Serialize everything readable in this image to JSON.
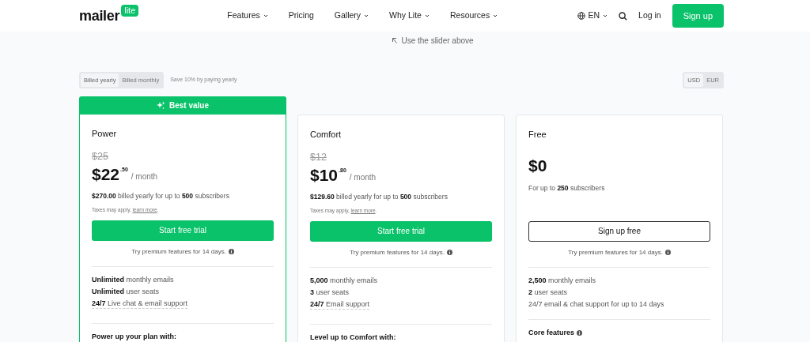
{
  "nav": {
    "logo_word": "mailer",
    "logo_badge": "lite",
    "menu": [
      {
        "label": "Features",
        "dropdown": true
      },
      {
        "label": "Pricing",
        "dropdown": false
      },
      {
        "label": "Gallery",
        "dropdown": true
      },
      {
        "label": "Why Lite",
        "dropdown": true
      },
      {
        "label": "Resources",
        "dropdown": true
      }
    ],
    "language": "EN",
    "login": "Log in",
    "signup": "Sign up"
  },
  "hint": "Use the slider above",
  "billing": {
    "options": [
      {
        "label": "Billed yearly",
        "selected": true
      },
      {
        "label": "Billed monthly",
        "selected": false
      }
    ],
    "note": "Save 10% by paying yearly"
  },
  "currency": [
    {
      "label": "USD",
      "selected": true
    },
    {
      "label": "EUR",
      "selected": false
    }
  ],
  "plans": [
    {
      "name": "Power",
      "badge": "Best value",
      "highlighted": true,
      "old_price": "$25",
      "price": "$22",
      "cents": ".50",
      "period": "/ month",
      "billing": "**$270.00** billed yearly for up to **500** subscribers",
      "taxes": {
        "text": "Taxes may apply, ",
        "link": "learn more",
        "end": "."
      },
      "button": {
        "label": "Start free trial",
        "kind": "primary"
      },
      "trial_note": "Try premium features for 14 days.",
      "features": [
        {
          "text": "**Unlimited** monthly emails",
          "dotted": false
        },
        {
          "text": "**Unlimited** user seats",
          "dotted": false
        },
        {
          "text": "**24/7** Live chat & email support",
          "dotted": true
        }
      ],
      "section_title": "Power up your plan with:",
      "section_info": false
    },
    {
      "name": "Comfort",
      "highlighted": false,
      "old_price": "$12",
      "price": "$10",
      "cents": ".80",
      "period": "/ month",
      "billing": "**$129.60** billed yearly for up to **500** subscribers",
      "taxes": {
        "text": "Taxes may apply, ",
        "link": "learn more",
        "end": "."
      },
      "button": {
        "label": "Start free trial",
        "kind": "primary"
      },
      "trial_note": "Try premium features for 14 days.",
      "features": [
        {
          "text": "**5,000** monthly emails",
          "dotted": false
        },
        {
          "text": "**3** user seats",
          "dotted": false
        },
        {
          "text": "**24/7** Email support",
          "dotted": true
        }
      ],
      "section_title": "Level up to Comfort with:",
      "section_info": false
    },
    {
      "name": "Free",
      "highlighted": false,
      "price": "$0",
      "billing": "For up to **250** subscribers",
      "button": {
        "label": "Sign up free",
        "kind": "outline"
      },
      "trial_note": "Try premium features for 14 days.",
      "features": [
        {
          "text": "**2,500** monthly emails",
          "dotted": false
        },
        {
          "text": "**2** user seats",
          "dotted": false
        },
        {
          "text": "24/7 email & chat support for up to 14 days",
          "dotted": false
        }
      ],
      "section_title": "Core features",
      "section_info": true
    }
  ]
}
